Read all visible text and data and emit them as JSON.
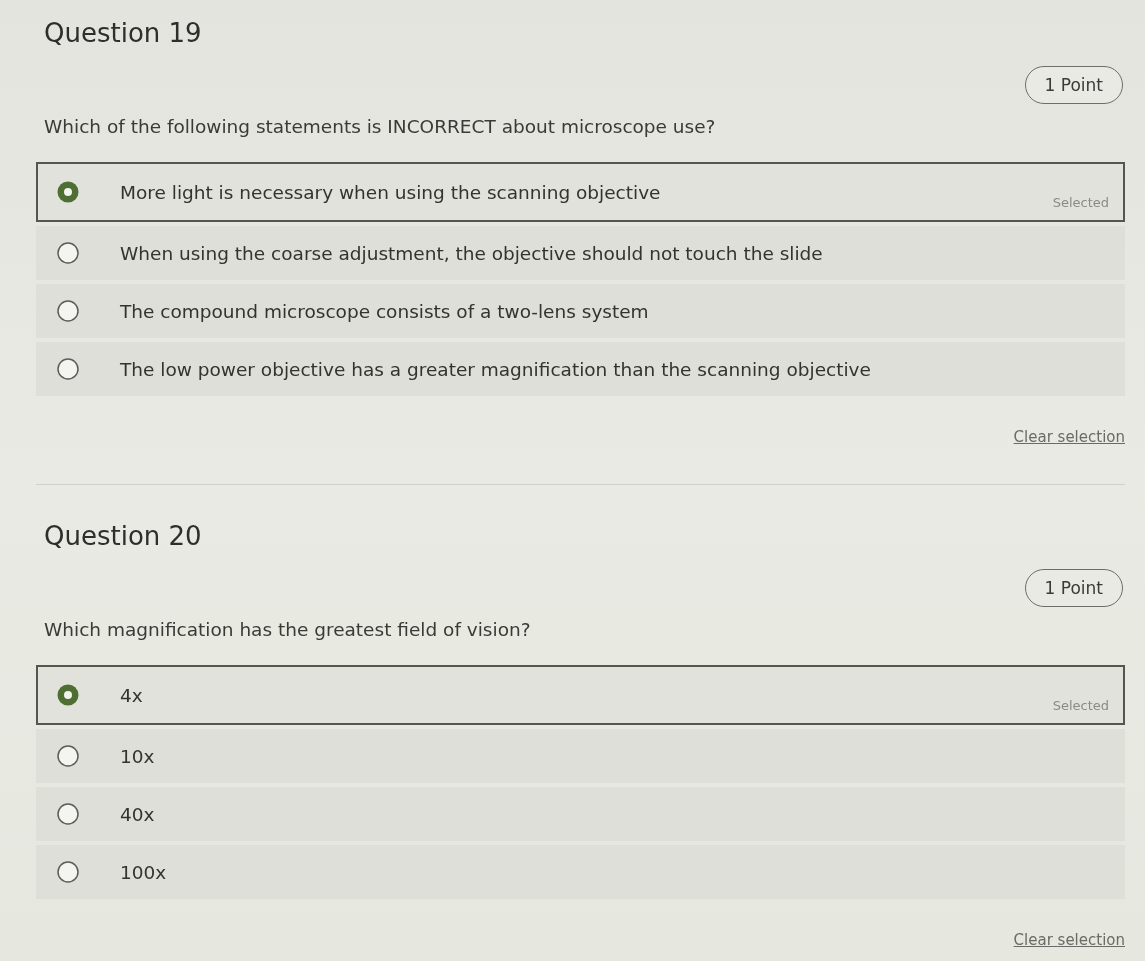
{
  "questions": [
    {
      "title": "Question 19",
      "points": "1 Point",
      "prompt": "Which of the following statements is INCORRECT about microscope use?",
      "options": [
        {
          "label": "More light is necessary when using the scanning objective",
          "selected": true,
          "note": "Selected"
        },
        {
          "label": "When using the coarse adjustment, the objective should not touch the slide",
          "selected": false
        },
        {
          "label": "The compound microscope consists of a two-lens system",
          "selected": false
        },
        {
          "label": "The low power objective has a greater magnification than the scanning objective",
          "selected": false
        }
      ],
      "clear": "Clear selection"
    },
    {
      "title": "Question 20",
      "points": "1 Point",
      "prompt": "Which magnification has the greatest field of vision?",
      "options": [
        {
          "label": "4x",
          "selected": true,
          "note": "Selected"
        },
        {
          "label": "10x",
          "selected": false
        },
        {
          "label": "40x",
          "selected": false
        },
        {
          "label": "100x",
          "selected": false
        }
      ],
      "clear": "Clear selection"
    }
  ]
}
